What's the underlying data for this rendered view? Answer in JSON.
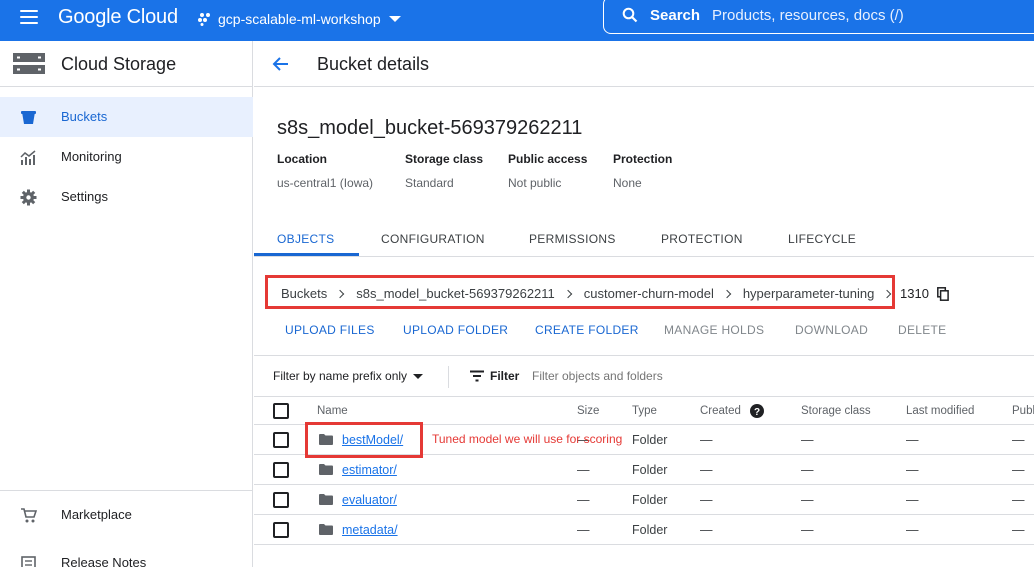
{
  "topbar": {
    "logo": "Google Cloud",
    "project": "gcp-scalable-ml-workshop",
    "search_label": "Search",
    "search_placeholder": "Products, resources, docs (/)"
  },
  "sidebar": {
    "title": "Cloud Storage",
    "items": [
      {
        "label": "Buckets",
        "icon": "bucket-icon",
        "active": true
      },
      {
        "label": "Monitoring",
        "icon": "monitoring-icon",
        "active": false
      },
      {
        "label": "Settings",
        "icon": "gear-icon",
        "active": false
      }
    ],
    "bottom_items": [
      {
        "label": "Marketplace",
        "icon": "cart-icon"
      },
      {
        "label": "Release Notes",
        "icon": "notes-icon"
      }
    ]
  },
  "page": {
    "title": "Bucket details",
    "bucket_name": "s8s_model_bucket-569379262211",
    "meta": [
      {
        "key": "Location",
        "value": "us-central1 (Iowa)"
      },
      {
        "key": "Storage class",
        "value": "Standard"
      },
      {
        "key": "Public access",
        "value": "Not public"
      },
      {
        "key": "Protection",
        "value": "None"
      }
    ],
    "tabs": [
      "OBJECTS",
      "CONFIGURATION",
      "PERMISSIONS",
      "PROTECTION",
      "LIFECYCLE"
    ],
    "active_tab": "OBJECTS",
    "breadcrumbs": [
      "Buckets",
      "s8s_model_bucket-569379262211",
      "customer-churn-model",
      "hyperparameter-tuning"
    ],
    "breadcrumb_extra": "1310",
    "actions": [
      "UPLOAD FILES",
      "UPLOAD FOLDER",
      "CREATE FOLDER",
      "MANAGE HOLDS",
      "DOWNLOAD",
      "DELETE"
    ],
    "filter_prefix_label": "Filter by name prefix only",
    "filter_label": "Filter",
    "filter_placeholder": "Filter objects and folders",
    "columns": [
      "Name",
      "Size",
      "Type",
      "Created",
      "Storage class",
      "Last modified",
      "Publ"
    ],
    "rows": [
      {
        "name": "bestModel/",
        "size": "—",
        "type": "Folder",
        "created": "—",
        "storage_class": "—",
        "last_modified": "—",
        "public": "—"
      },
      {
        "name": "estimator/",
        "size": "—",
        "type": "Folder",
        "created": "—",
        "storage_class": "—",
        "last_modified": "—",
        "public": "—"
      },
      {
        "name": "evaluator/",
        "size": "—",
        "type": "Folder",
        "created": "—",
        "storage_class": "—",
        "last_modified": "—",
        "public": "—"
      },
      {
        "name": "metadata/",
        "size": "—",
        "type": "Folder",
        "created": "—",
        "storage_class": "—",
        "last_modified": "—",
        "public": "—"
      }
    ],
    "annotation": "Tuned model we will use for scoring"
  },
  "colors": {
    "brand_blue": "#1a73e8",
    "link_blue": "#1967d2",
    "highlight_red": "#e53935"
  }
}
